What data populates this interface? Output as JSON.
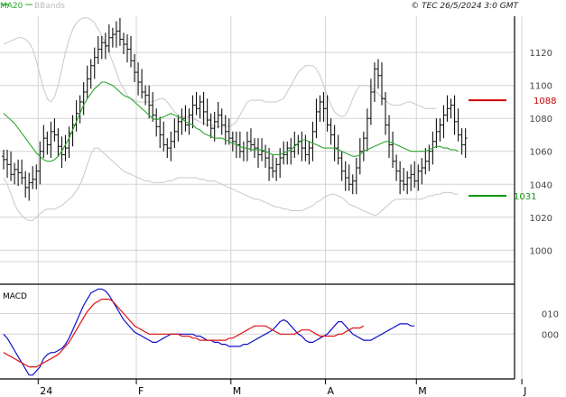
{
  "header": {
    "ma_label": "MA20",
    "bbands_label": "BBands",
    "copyright": "© TEC 26/5/2024 3:0 GMT"
  },
  "colors": {
    "ma": "#2ca52c",
    "bbands": "#c8c8c8",
    "price_bar": "#111111",
    "macd_line": "#1010cc",
    "signal_line": "#dd1111",
    "resistance": "#cc0000",
    "support": "#119911",
    "grid": "#d4d4d4"
  },
  "chart_data": [
    {
      "type": "ohlc",
      "title": "",
      "ylim": [
        981,
        1142
      ],
      "y_ticks": [
        {
          "value": 1120,
          "label": "1120"
        },
        {
          "value": 1100,
          "label": "1100"
        },
        {
          "value": 1080,
          "label": "1080"
        },
        {
          "value": 1060,
          "label": "1060"
        },
        {
          "value": 1040,
          "label": "1040"
        },
        {
          "value": 1020,
          "label": "1020"
        },
        {
          "value": 1000,
          "label": "1000"
        }
      ],
      "x_ticks": [
        "24",
        "F",
        "M",
        "A",
        "M",
        "J"
      ],
      "x_tick_index": [
        10,
        37,
        63,
        89,
        114,
        143
      ],
      "num_sessions": 140,
      "levels": [
        {
          "name": "resistance",
          "value": 1091,
          "label": "1088"
        },
        {
          "name": "support",
          "value": 1033,
          "label": "1031"
        }
      ],
      "close": [
        1055,
        1052,
        1046,
        1049,
        1047,
        1044,
        1038,
        1041,
        1043,
        1048,
        1060,
        1068,
        1064,
        1072,
        1070,
        1063,
        1058,
        1062,
        1071,
        1076,
        1083,
        1090,
        1096,
        1104,
        1112,
        1117,
        1122,
        1126,
        1124,
        1129,
        1131,
        1133,
        1128,
        1125,
        1122,
        1115,
        1108,
        1102,
        1096,
        1094,
        1088,
        1082,
        1075,
        1070,
        1064,
        1062,
        1066,
        1072,
        1078,
        1080,
        1076,
        1082,
        1088,
        1086,
        1090,
        1084,
        1079,
        1074,
        1078,
        1082,
        1076,
        1072,
        1068,
        1066,
        1064,
        1060,
        1062,
        1066,
        1064,
        1062,
        1058,
        1060,
        1056,
        1050,
        1048,
        1052,
        1056,
        1058,
        1062,
        1060,
        1064,
        1066,
        1062,
        1058,
        1062,
        1072,
        1084,
        1090,
        1086,
        1076,
        1070,
        1062,
        1056,
        1048,
        1044,
        1040,
        1042,
        1050,
        1060,
        1068,
        1080,
        1096,
        1110,
        1106,
        1092,
        1076,
        1064,
        1054,
        1048,
        1042,
        1040,
        1044,
        1046,
        1042,
        1048,
        1050,
        1054,
        1060,
        1066,
        1072,
        1076,
        1082,
        1086,
        1088,
        1078,
        1070,
        1064,
        1068
      ],
      "ma20": [
        1083,
        1081,
        1079,
        1077,
        1074,
        1071,
        1068,
        1065,
        1062,
        1059,
        1057,
        1055,
        1054,
        1054,
        1055,
        1057,
        1060,
        1064,
        1068,
        1073,
        1078,
        1083,
        1088,
        1092,
        1095,
        1098,
        1100,
        1102,
        1102,
        1101,
        1100,
        1098,
        1096,
        1094,
        1093,
        1092,
        1090,
        1088,
        1086,
        1084,
        1082,
        1080,
        1079,
        1080,
        1081,
        1082,
        1083,
        1082,
        1081,
        1080,
        1078,
        1077,
        1076,
        1074,
        1073,
        1071,
        1070,
        1069,
        1068,
        1068,
        1068,
        1067,
        1066,
        1065,
        1064,
        1063,
        1062,
        1062,
        1061,
        1061,
        1061,
        1061,
        1060,
        1059,
        1058,
        1058,
        1058,
        1059,
        1060,
        1061,
        1063,
        1065,
        1067,
        1067,
        1066,
        1065,
        1064,
        1063,
        1062,
        1062,
        1062,
        1062,
        1061,
        1060,
        1059,
        1058,
        1057,
        1057,
        1058,
        1060,
        1061,
        1062,
        1063,
        1064,
        1065,
        1066,
        1066,
        1065,
        1064,
        1063,
        1062,
        1061,
        1060,
        1060,
        1060,
        1060,
        1060,
        1061,
        1062,
        1063,
        1063,
        1062,
        1062,
        1061,
        1061,
        1060
      ],
      "bb_upper": [
        1125,
        1126,
        1127,
        1128,
        1129,
        1129,
        1128,
        1126,
        1122,
        1115,
        1106,
        1098,
        1092,
        1090,
        1093,
        1100,
        1110,
        1120,
        1128,
        1134,
        1138,
        1140,
        1141,
        1141,
        1140,
        1138,
        1134,
        1130,
        1126,
        1120,
        1114,
        1108,
        1102,
        1098,
        1094,
        1092,
        1091,
        1090,
        1090,
        1090,
        1090,
        1090,
        1091,
        1092,
        1092,
        1090,
        1087,
        1084,
        1082,
        1081,
        1081,
        1081,
        1080,
        1079,
        1078,
        1077,
        1076,
        1076,
        1075,
        1075,
        1075,
        1075,
        1075,
        1076,
        1078,
        1082,
        1086,
        1090,
        1091,
        1091,
        1091,
        1091,
        1090,
        1090,
        1090,
        1090,
        1091,
        1092,
        1096,
        1100,
        1104,
        1108,
        1110,
        1112,
        1112,
        1112,
        1110,
        1106,
        1100,
        1094,
        1088,
        1084,
        1082,
        1081,
        1082,
        1086,
        1092,
        1097,
        1100,
        1100,
        1100,
        1099,
        1097,
        1095,
        1093,
        1091,
        1089,
        1088,
        1088,
        1088,
        1089,
        1090,
        1090,
        1089,
        1088,
        1087,
        1086,
        1086,
        1086,
        1086
      ],
      "bb_lower": [
        1044,
        1040,
        1034,
        1028,
        1024,
        1021,
        1019,
        1018,
        1018,
        1020,
        1022,
        1024,
        1025,
        1025,
        1025,
        1026,
        1027,
        1029,
        1031,
        1033,
        1036,
        1040,
        1045,
        1052,
        1058,
        1062,
        1062,
        1060,
        1058,
        1056,
        1054,
        1052,
        1050,
        1048,
        1047,
        1046,
        1045,
        1044,
        1043,
        1042,
        1042,
        1041,
        1041,
        1041,
        1041,
        1042,
        1042,
        1043,
        1044,
        1044,
        1044,
        1044,
        1044,
        1044,
        1043,
        1043,
        1042,
        1042,
        1042,
        1041,
        1040,
        1039,
        1038,
        1037,
        1036,
        1035,
        1034,
        1033,
        1032,
        1031,
        1031,
        1030,
        1029,
        1028,
        1027,
        1026,
        1026,
        1025,
        1025,
        1024,
        1024,
        1024,
        1024,
        1025,
        1026,
        1027,
        1029,
        1030,
        1032,
        1033,
        1034,
        1034,
        1033,
        1032,
        1030,
        1028,
        1027,
        1026,
        1025,
        1024,
        1023,
        1022,
        1021,
        1022,
        1024,
        1026,
        1028,
        1030,
        1031,
        1031,
        1031,
        1031,
        1031,
        1031,
        1031,
        1031,
        1032,
        1033,
        1033,
        1034,
        1034,
        1035,
        1035,
        1035,
        1034,
        1034
      ]
    },
    {
      "type": "line",
      "title": "MACD",
      "ylim": [
        -21,
        23
      ],
      "y_ticks": [
        {
          "value": 10,
          "label": "010"
        },
        {
          "value": 0,
          "label": "000"
        }
      ],
      "series": [
        {
          "name": "MACD",
          "values": [
            0,
            -2,
            -5,
            -8,
            -11,
            -14,
            -17,
            -20,
            -20,
            -18,
            -16,
            -12,
            -10,
            -9,
            -9,
            -8,
            -7,
            -5,
            -2,
            2,
            6,
            10,
            14,
            17,
            20,
            21,
            22,
            22,
            21,
            19,
            16,
            13,
            10,
            7,
            5,
            3,
            1,
            0,
            -1,
            -2,
            -3,
            -4,
            -4,
            -3,
            -2,
            -1,
            0,
            0,
            0,
            0,
            0,
            0,
            0,
            -1,
            -1,
            -2,
            -3,
            -3,
            -4,
            -4,
            -5,
            -5,
            -6,
            -6,
            -6,
            -6,
            -5,
            -5,
            -4,
            -3,
            -2,
            -1,
            0,
            1,
            2,
            4,
            6,
            7,
            6,
            4,
            2,
            0,
            -1,
            -3,
            -4,
            -4,
            -3,
            -2,
            -1,
            0,
            2,
            4,
            6,
            6,
            4,
            2,
            0,
            -1,
            -2,
            -3,
            -3,
            -3,
            -2,
            -1,
            0,
            1,
            2,
            3,
            4,
            5,
            5,
            5,
            4,
            4
          ],
          "color_key": "macd_line"
        },
        {
          "name": "Signal",
          "values": [
            -9,
            -10,
            -11,
            -12,
            -13,
            -14,
            -15,
            -16,
            -16,
            -16,
            -15,
            -14,
            -13,
            -12,
            -11,
            -10,
            -8,
            -6,
            -4,
            -1,
            2,
            5,
            8,
            11,
            13,
            15,
            16,
            17,
            17,
            17,
            16,
            14,
            12,
            10,
            8,
            6,
            4,
            3,
            2,
            1,
            0,
            0,
            0,
            0,
            0,
            0,
            0,
            0,
            0,
            -1,
            -1,
            -1,
            -2,
            -2,
            -3,
            -3,
            -3,
            -3,
            -3,
            -3,
            -3,
            -3,
            -2,
            -2,
            -1,
            0,
            1,
            2,
            3,
            4,
            4,
            4,
            4,
            3,
            2,
            1,
            0,
            0,
            0,
            0,
            0,
            1,
            2,
            2,
            2,
            1,
            0,
            -1,
            -1,
            -1,
            -1,
            -1,
            0,
            0,
            1,
            2,
            3,
            3,
            3,
            4
          ],
          "color_key": "signal_line"
        }
      ]
    }
  ]
}
